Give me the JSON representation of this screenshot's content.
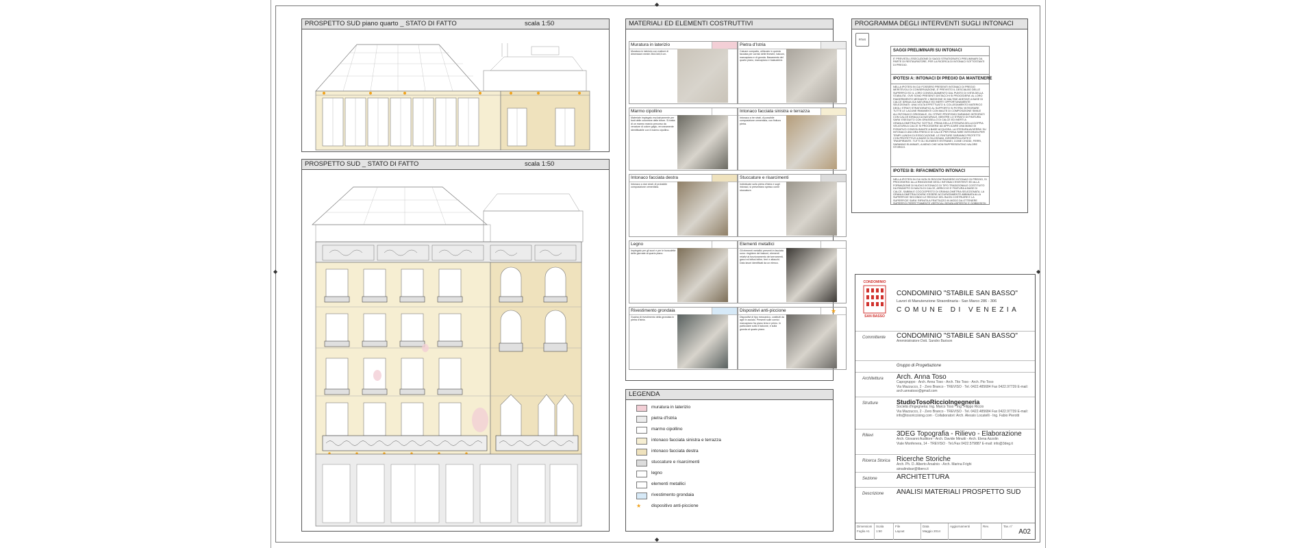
{
  "elevation_top": {
    "title": "PROSPETTO SUD piano quarto _ STATO DI FATTO",
    "scale": "scala 1:50"
  },
  "elevation_main": {
    "title": "PROSPETTO SUD _ STATO DI FATTO",
    "scale": "scala 1:50"
  },
  "materials": {
    "title": "MATERIALI ED ELEMENTI COSTRUTTIVI",
    "items": [
      {
        "label": "Muratura in laterizio",
        "text": "Muratura in laterizio con mattoni di dimensioni medie 26x13x5,5 cm.",
        "swatch": "#f3cfd6",
        "photo": "#c9c3b8"
      },
      {
        "label": "Pietra d'Istria",
        "text": "Calcare compatto, utilizzato in questa facciata per cornici delle finestre, balconi, marcapiano e di gronda. Basamento del quarto piano, marcapiano e balaustrine.",
        "swatch": "#ececec",
        "photo": "#a9a49c"
      },
      {
        "label": "Marmo cipollino",
        "text": "Materiale impiegato esclusivamente per fusti delle colonnine delle bifore. Si tratta di un marmo marcio percorso da venature di colore grigio, erroneamente identificabile con il marmo cipollino.",
        "swatch": "#ffffff",
        "photo": "#6b6a62"
      },
      {
        "label": "Intonaco facciata sinistra e terrazza",
        "text": "Intonaco a tre strati, di possibile composizione cementizia, con finitura pietra.",
        "swatch": "#f6eed2",
        "photo": "#b59d7a"
      },
      {
        "label": "Intonaco facciata destra",
        "text": "Intonaco a due strati, di probabile composizione cementizia.",
        "swatch": "#efe2bd",
        "photo": "#8f7f66"
      },
      {
        "label": "Stuccature e risarcimenti",
        "text": "Individuate sulla pietra d'Istria e sugli intonaci, si presentano spesso come stuccature.",
        "swatch": "#dcdcdc",
        "photo": "#9b968c"
      },
      {
        "label": "Legno",
        "text": "Impiegato per gli scuri e per le bussolette delle giornate al quarto piano.",
        "swatch": "#ffffff",
        "photo": "#7d6f58"
      },
      {
        "label": "Elementi metallici",
        "text": "Gli elementi metallici presenti in facciata sono: ringhiere dei balconi, elementi relativi al funzionamento dei serramenti, ganci ed infissi infine, ferri e attacchi. Dato lavori identificati da un elenco.",
        "swatch": "#ffffff",
        "photo": "#3d3a36"
      },
      {
        "label": "Rivestimento grondaia",
        "text": "Guaina di rivestimento della grondaia in pietra d'Istria.",
        "swatch": "#d6e9f7",
        "photo": "#58605f"
      },
      {
        "label": "Dispositivi anti-piccione",
        "text": "Dispositivi di tipo meccanico, costituiti da aghi in acciaio. Presenti sulle cornici marcapiano fra piano terra e primo. In particolare sotto il balcone, e sulla gronda al quarto piano.",
        "swatch": "star",
        "photo": "#6c6a66"
      }
    ]
  },
  "legend": {
    "title": "LEGENDA",
    "items": [
      {
        "label": "muratura in laterizio",
        "color": "#f3cfd6"
      },
      {
        "label": "pietra d'Istria",
        "color": "#ececec"
      },
      {
        "label": "marmo cipollino",
        "color": "#ffffff"
      },
      {
        "label": "intonaco facciata sinistra e terrazza",
        "color": "#f6eed2"
      },
      {
        "label": "intonaco facciata destra",
        "color": "#efe2bd"
      },
      {
        "label": "stuccature e risarcimenti",
        "color": "#dcdcdc"
      },
      {
        "label": "legno",
        "color": "#ffffff"
      },
      {
        "label": "elementi metallici",
        "color": "#ffffff"
      },
      {
        "label": "rivestimento grondaia",
        "color": "#d6e9f7"
      },
      {
        "label": "dispositivo anti-piccione",
        "color": "star"
      }
    ]
  },
  "program": {
    "title": "PROGRAMMA DEGLI INTERVENTI SUGLI INTONACI",
    "stamp": "RTAS",
    "sec1_title": "SAGGI PRELIMINARI SU INTONACI",
    "sec1_text": "E' PREVISTA L'ESECUZIONE DI SAGGI STRATIGRAFICI PRELIMINARI DA PARTE DI RESTAURATORE, PER LA RICERCA DI INTONACI SOTTOSTANTI DI PREGIO.",
    "sec2_title": "IPOTESI A: INTONACI DI PREGIO DA MANTENERE",
    "sec2_text": "NELLA IPOTESI IN CUI FOSSERO PRESENTI INTONACI DI PREGIO MERITEVOLI DI CONSERVAZIONE, E' PREVISTO IL DESCIALBO DELLE SUPERFICI ED IL LORO CONSOLIDAMENTO DAL PUNTO DI VISTA DELLA STABILITA'. OVE SONO PRESENTI DISTACCHI SI PROCEDERA' AL LORO RIADERIMENTO MEDIANTE L'INIEZIONE DI MALTINE ADESIVE A BASE DI CALCE IDRAULICA NATURALE ED INERTI OPPORTUNAMENTE SELEZIONATI. UNA VOLTA EFFETTUATO IL COLLEGAMENTO MATERICO DEGLI STRATI STRATIGRAFICI AL SUPPORTO SI POTRA' INTEGRARE TUTTE LE LACUNE RIMANENTI CON MALTE DI COMPOSIZIONE SIMILE ALL'INTONACO ORIGINALE. GLI STRATI PROFONDI SARANNO INTEGRATI CON CALCE IDRAULICA NATURALE, MENTRE LO STRATO DI FINITURA SARA' ESEGUITO CON GRASSELLO DI CALCE ED INERTI A GRANULOMETRIA PIU' SOTTILE. PRIMA DELLA STESURA DELLA DOPPIA VELATURA A CALCE SI PROCEDERA' AD APPLICARE UNA MANO DI FISSATIVO CONSOLIDANTE A BASE ACQUOSA. LA STESURA AVVERRA' SU INTONACO ANCORA FRESCO DI CALCE PER RISULTARE INTEGRATA PER TEMPI LUNGHI DI ESSICCAZIONE. LE FINITURE SARANNO PROTETTE CON PROTETTIVO A BASE DI SILOSSANI, IDROREPELLENTE E TRASPIRANTE. TUTTI GLI ELEMENTI ESTRANEI, COME CHIODI, FERRI, SARANNO ELIMINATI, A MENO CHE NON RAPPRESENTINO VALORE STORICO.",
    "sec3_title": "IPOTESI B: RIFACIMENTO INTONACI",
    "sec3_text": "NELLA IPOTESI IN CUI NON SI RISCONTRASSERO INTONACI DI PREGIO, SI PROCEDERA' ALLA RIMOZIONE DEGLI INTONACI ESISTENTI ED ALLA FORMAZIONE DI NUOVO INTONACO DI TIPO TRADIZIONALE COSTITUITO DA RINZAFFO DI MALTA DI CALCE, ARRICCIO E FINITURA A BASE DI CALCE, SABBIA E COCCIOPESTO DI GRANULOMETRIA SELEZIONATA. LA GRANULOMETRIA DOVRA' ESSERE ACCURATAMENTE ABBINATA ALLA SUPERFICIE SECONDO LE REGOLE DEL BUON COSTRUIRE E LA SUPERFICIE SARA' RIFINITA A FRATTAZZO IN MODO DA OTTENERE SUPERFICI PERFETTAMENTE VERTICALI SENZA ASPERITA' E GOBBOSITA'."
  },
  "titleblock": {
    "logo_line1": "CONDOMINIO",
    "logo_line2": "SAN BASSO",
    "project_name": "CONDOMINIO \"STABILE SAN BASSO\"",
    "project_sub": "Lavori di Manutenzione Straordinaria  -  San Marco 286 - 306",
    "city": "COMUNE DI VENEZIA",
    "rows": [
      {
        "label": "Committente",
        "line1": "CONDOMINIO \"STABILE SAN BASSO\"",
        "line2": "Amministratore Dott. Sandro Barison",
        "line3": ""
      },
      {
        "label": "",
        "line1": "Gruppo di Progettazione",
        "line2": "",
        "line3": ""
      },
      {
        "label": "Architettura",
        "line1": "Arch. Anna Toso",
        "line2": "Capogruppo  ·  Arch. Anna Toso - Arch. Tito Toso - Arch. Pio Toso",
        "line3": "Via Mazzucco, 2 - Zero Branco - TREVISO  ·  Tel. 0422.485684 Fax 0422.97739 E-mail: arch.annatoso@gmail.com"
      },
      {
        "label": "Strutture",
        "line1": "StudioTosoRiccioIngegneria",
        "line2": "Società d'ingegneria: Ing. Marco Toso - Ing. Filippo Riccio",
        "line3": "Via Mazzucco, 2 - Zero Branco - TREVISO  ·  Tel. 0422.485684 Fax 0422.97739 E-mail: info@tosoriccioing.com  ·  Collaboratori: Arch. Alessio Locatelli - Ing. Fabio Pierotti"
      },
      {
        "label": "Rilievi",
        "line1": "3DEG    Topografia  -  Rilievo  -  Elaborazione",
        "line2": "Arch. Giovanni Auditore - Arch. Davide Minutti - Arch. Elena Azzolin",
        "line3": "Viale Monfenera, 14 - TREVISO  ·  Tel./Fax 0422.579887 E-mail: info@3deg.it"
      },
      {
        "label": "Ricerca Storica",
        "line1": "Ricerche Storiche",
        "line2": "Arch. Ph. D. Alberto Arsalnio - Arch. Marina Frighi",
        "line3": "airsalindsar@libero.it"
      },
      {
        "label": "Sezione",
        "line1": "ARCHITETTURA",
        "line2": "",
        "line3": ""
      },
      {
        "label": "Descrizione",
        "line1": "ANALISI MATERIALI PROSPETTO SUD",
        "line2": "",
        "line3": ""
      }
    ],
    "footer": [
      {
        "label": "Dimensioni",
        "value": "Foglio A1"
      },
      {
        "label": "Scala",
        "value": "1:50"
      },
      {
        "label": "File",
        "value": "Layout"
      },
      {
        "label": "Data",
        "value": "Maggio 2014"
      },
      {
        "label": "Aggiornamenti",
        "value": ""
      },
      {
        "label": "Rev.",
        "value": ""
      },
      {
        "label": "Tav. n°",
        "value": "A02"
      }
    ]
  }
}
